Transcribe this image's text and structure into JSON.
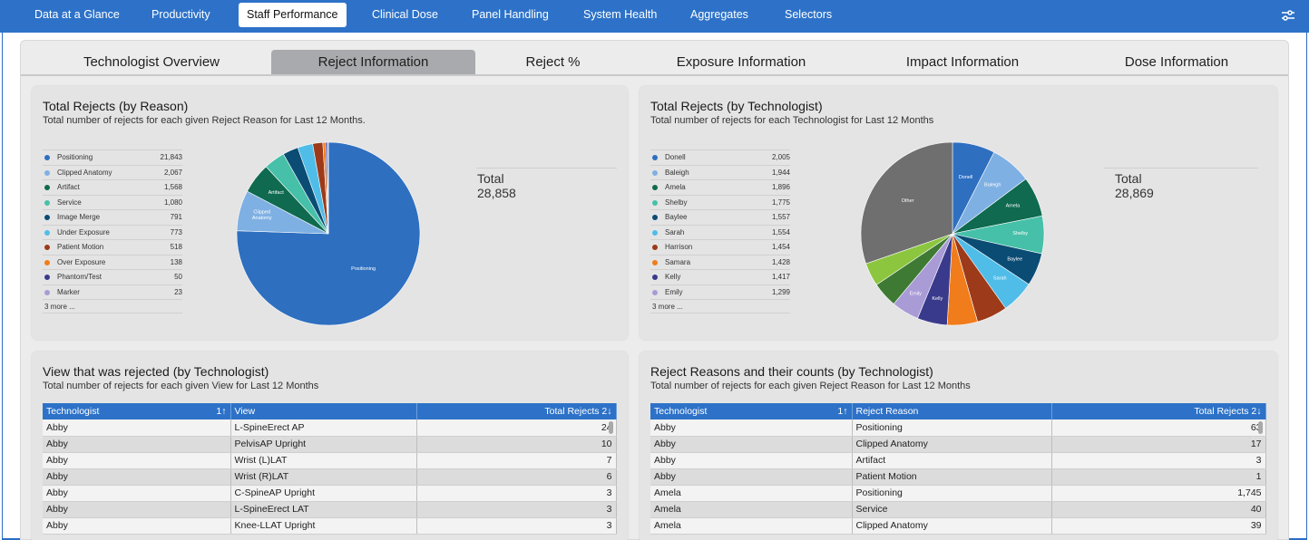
{
  "nav": {
    "items": [
      "Data at a Glance",
      "Productivity",
      "Staff Performance",
      "Clinical Dose",
      "Panel Handling",
      "System Health",
      "Aggregates",
      "Selectors"
    ],
    "active": "Staff Performance"
  },
  "tabs": [
    "Technologist Overview",
    "Reject Information",
    "Reject %",
    "Exposure Information",
    "Impact Information",
    "Dose Information"
  ],
  "active_tab": "Reject Information",
  "panel_reason": {
    "title": "Total Rejects (by Reason)",
    "subtitle": "Total number of rejects for each given Reject Reason for Last 12 Months.",
    "legend": [
      {
        "label": "Positioning",
        "value": "21,843",
        "color": "#2e6fc0"
      },
      {
        "label": "Clipped Anatomy",
        "value": "2,067",
        "color": "#7fb0e3"
      },
      {
        "label": "Artifact",
        "value": "1,568",
        "color": "#0f6a4f"
      },
      {
        "label": "Service",
        "value": "1,080",
        "color": "#46c0a8"
      },
      {
        "label": "Image Merge",
        "value": "791",
        "color": "#0b4c74"
      },
      {
        "label": "Under Exposure",
        "value": "773",
        "color": "#4fbde8"
      },
      {
        "label": "Patient Motion",
        "value": "518",
        "color": "#9c3a1a"
      },
      {
        "label": "Over Exposure",
        "value": "138",
        "color": "#f07c1c"
      },
      {
        "label": "Phantom/Test",
        "value": "50",
        "color": "#3a3a8c"
      },
      {
        "label": "Marker",
        "value": "23",
        "color": "#a99bd6"
      }
    ],
    "more": "3 more ...",
    "total_label": "Total",
    "total_value": "28,858",
    "slice_labels": [
      "Positioning",
      "Clipped",
      "Anatomy",
      "Artifact"
    ]
  },
  "panel_tech": {
    "title": "Total Rejects (by Technologist)",
    "subtitle": "Total number of rejects for each Technologist for Last 12 Months",
    "legend": [
      {
        "label": "Donell",
        "value": "2,005",
        "color": "#2e6fc0"
      },
      {
        "label": "Baleigh",
        "value": "1,944",
        "color": "#7fb0e3"
      },
      {
        "label": "Amela",
        "value": "1,896",
        "color": "#0f6a4f"
      },
      {
        "label": "Shelby",
        "value": "1,775",
        "color": "#46c0a8"
      },
      {
        "label": "Baylee",
        "value": "1,557",
        "color": "#0b4c74"
      },
      {
        "label": "Sarah",
        "value": "1,554",
        "color": "#4fbde8"
      },
      {
        "label": "Harrison",
        "value": "1,454",
        "color": "#9c3a1a"
      },
      {
        "label": "Samara",
        "value": "1,428",
        "color": "#f07c1c"
      },
      {
        "label": "Kelly",
        "value": "1,417",
        "color": "#3a3a8c"
      },
      {
        "label": "Emily",
        "value": "1,299",
        "color": "#a99bd6"
      }
    ],
    "more": "3 more ...",
    "total_label": "Total",
    "total_value": "28,869",
    "slice_labels": [
      "Donell",
      "Baleigh",
      "Amela",
      "Shelby",
      "Baylee",
      "Sarah",
      "Emily",
      "Kelly",
      "Other"
    ]
  },
  "table_view": {
    "title": "View that was rejected (by Technologist)",
    "subtitle": "Total number of rejects for each given View for Last 12 Months",
    "headers": [
      "Technologist",
      "View",
      "Total Rejects"
    ],
    "sort1": "1↑",
    "sort2": "2↓",
    "rows": [
      [
        "Abby",
        "L-SpineErect AP",
        "24"
      ],
      [
        "Abby",
        "PelvisAP Upright",
        "10"
      ],
      [
        "Abby",
        "Wrist (L)LAT",
        "7"
      ],
      [
        "Abby",
        "Wrist (R)LAT",
        "6"
      ],
      [
        "Abby",
        "C-SpineAP Upright",
        "3"
      ],
      [
        "Abby",
        "L-SpineErect LAT",
        "3"
      ],
      [
        "Abby",
        "Knee-LLAT Upright",
        "3"
      ]
    ]
  },
  "table_reason": {
    "title": "Reject Reasons and their counts (by Technologist)",
    "subtitle": "Total number of rejects for each given Reject Reason for Last 12 Months",
    "headers": [
      "Technologist",
      "Reject Reason",
      "Total Rejects"
    ],
    "sort1": "1↑",
    "sort2": "2↓",
    "rows": [
      [
        "Abby",
        "Positioning",
        "63"
      ],
      [
        "Abby",
        "Clipped Anatomy",
        "17"
      ],
      [
        "Abby",
        "Artifact",
        "3"
      ],
      [
        "Abby",
        "Patient Motion",
        "1"
      ],
      [
        "Amela",
        "Positioning",
        "1,745"
      ],
      [
        "Amela",
        "Service",
        "40"
      ],
      [
        "Amela",
        "Clipped Anatomy",
        "39"
      ]
    ]
  }
}
